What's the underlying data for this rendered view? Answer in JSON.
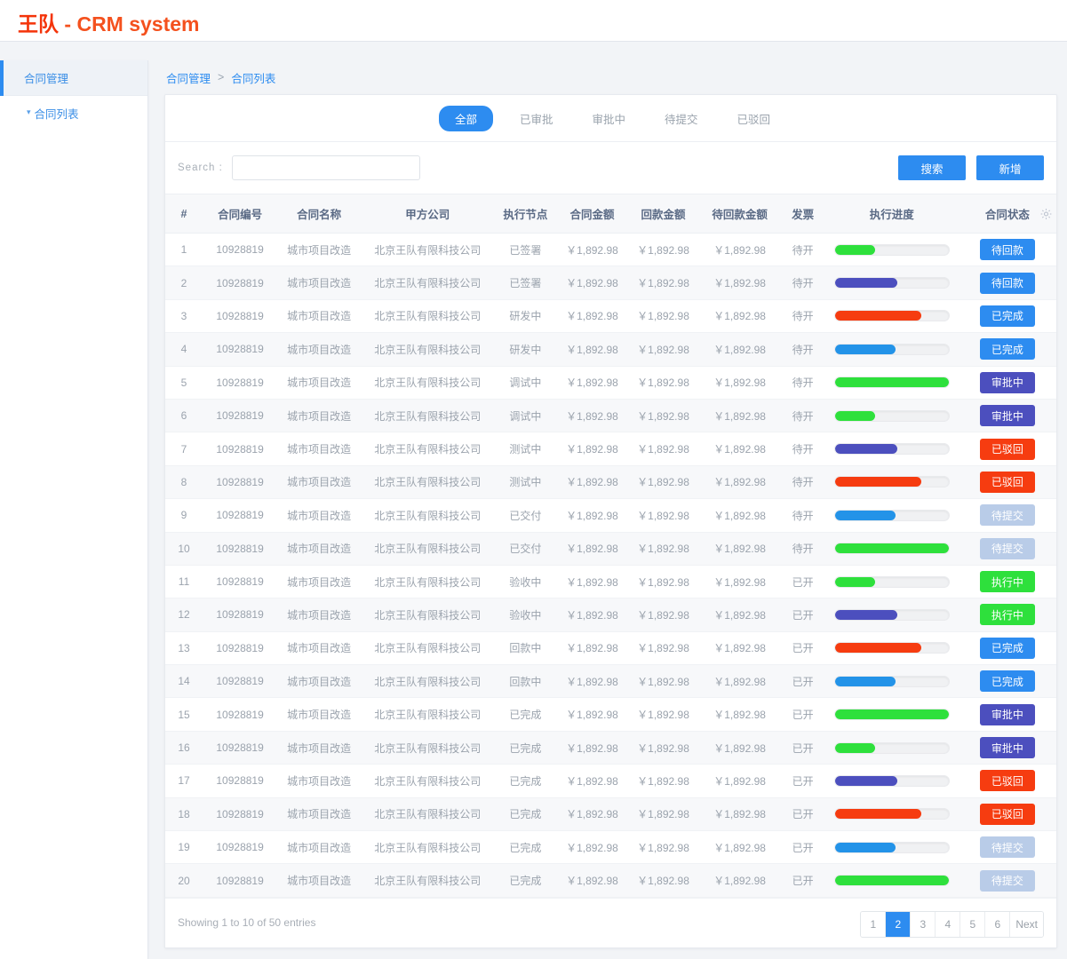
{
  "header": {
    "brand_cn": "王队",
    "brand_sep": " - ",
    "brand_en": "CRM system",
    "brand_color": "#f4511e"
  },
  "sidebar": {
    "items": [
      {
        "label": "合同管理",
        "active": true
      },
      {
        "label": "合同列表",
        "sub": true,
        "chevron": "chevron-down-icon"
      }
    ]
  },
  "breadcrumb": {
    "parent": "合同管理",
    "separator": ">",
    "current": "合同列表"
  },
  "tabs": [
    {
      "label": "全部",
      "active": true
    },
    {
      "label": "已审批",
      "active": false
    },
    {
      "label": "审批中",
      "active": false
    },
    {
      "label": "待提交",
      "active": false
    },
    {
      "label": "已驳回",
      "active": false
    }
  ],
  "search": {
    "label": "Search :",
    "value": "",
    "placeholder": "",
    "search_button": "搜索",
    "add_button": "新增"
  },
  "table": {
    "columns": [
      "#",
      "合同编号",
      "合同名称",
      "甲方公司",
      "执行节点",
      "合同金额",
      "回款金额",
      "待回款金额",
      "发票",
      "执行进度",
      "合同状态"
    ],
    "settings_icon": "gear-icon",
    "rows": [
      {
        "index": "1",
        "code": "10928819",
        "name": "城市项目改造",
        "company": "北京王队有限科技公司",
        "node": "已签署",
        "amount": "￥1,892.98",
        "received": "￥1,892.98",
        "pending": "￥1,892.98",
        "invoice": "待开",
        "progress": 35,
        "progress_color": "#2ee03c",
        "status": "待回款",
        "status_color": "#2d8cf0"
      },
      {
        "index": "2",
        "code": "10928819",
        "name": "城市项目改造",
        "company": "北京王队有限科技公司",
        "node": "已签署",
        "amount": "￥1,892.98",
        "received": "￥1,892.98",
        "pending": "￥1,892.98",
        "invoice": "待开",
        "progress": 55,
        "progress_color": "#4c4fbe",
        "status": "待回款",
        "status_color": "#2d8cf0"
      },
      {
        "index": "3",
        "code": "10928819",
        "name": "城市项目改造",
        "company": "北京王队有限科技公司",
        "node": "研发中",
        "amount": "￥1,892.98",
        "received": "￥1,892.98",
        "pending": "￥1,892.98",
        "invoice": "待开",
        "progress": 76,
        "progress_color": "#f63c10",
        "status": "已完成",
        "status_color": "#2d8cf0"
      },
      {
        "index": "4",
        "code": "10928819",
        "name": "城市项目改造",
        "company": "北京王队有限科技公司",
        "node": "研发中",
        "amount": "￥1,892.98",
        "received": "￥1,892.98",
        "pending": "￥1,892.98",
        "invoice": "待开",
        "progress": 53,
        "progress_color": "#2393e8",
        "status": "已完成",
        "status_color": "#2d8cf0"
      },
      {
        "index": "5",
        "code": "10928819",
        "name": "城市项目改造",
        "company": "北京王队有限科技公司",
        "node": "调试中",
        "amount": "￥1,892.98",
        "received": "￥1,892.98",
        "pending": "￥1,892.98",
        "invoice": "待开",
        "progress": 100,
        "progress_color": "#2ee03c",
        "status": "审批中",
        "status_color": "#4c4fbe"
      },
      {
        "index": "6",
        "code": "10928819",
        "name": "城市项目改造",
        "company": "北京王队有限科技公司",
        "node": "调试中",
        "amount": "￥1,892.98",
        "received": "￥1,892.98",
        "pending": "￥1,892.98",
        "invoice": "待开",
        "progress": 35,
        "progress_color": "#2ee03c",
        "status": "审批中",
        "status_color": "#4c4fbe"
      },
      {
        "index": "7",
        "code": "10928819",
        "name": "城市项目改造",
        "company": "北京王队有限科技公司",
        "node": "测试中",
        "amount": "￥1,892.98",
        "received": "￥1,892.98",
        "pending": "￥1,892.98",
        "invoice": "待开",
        "progress": 55,
        "progress_color": "#4c4fbe",
        "status": "已驳回",
        "status_color": "#f63c10"
      },
      {
        "index": "8",
        "code": "10928819",
        "name": "城市项目改造",
        "company": "北京王队有限科技公司",
        "node": "测试中",
        "amount": "￥1,892.98",
        "received": "￥1,892.98",
        "pending": "￥1,892.98",
        "invoice": "待开",
        "progress": 76,
        "progress_color": "#f63c10",
        "status": "已驳回",
        "status_color": "#f63c10"
      },
      {
        "index": "9",
        "code": "10928819",
        "name": "城市项目改造",
        "company": "北京王队有限科技公司",
        "node": "已交付",
        "amount": "￥1,892.98",
        "received": "￥1,892.98",
        "pending": "￥1,892.98",
        "invoice": "待开",
        "progress": 53,
        "progress_color": "#2393e8",
        "status": "待提交",
        "status_color": "#b9cce8"
      },
      {
        "index": "10",
        "code": "10928819",
        "name": "城市项目改造",
        "company": "北京王队有限科技公司",
        "node": "已交付",
        "amount": "￥1,892.98",
        "received": "￥1,892.98",
        "pending": "￥1,892.98",
        "invoice": "待开",
        "progress": 100,
        "progress_color": "#2ee03c",
        "status": "待提交",
        "status_color": "#b9cce8"
      },
      {
        "index": "11",
        "code": "10928819",
        "name": "城市项目改造",
        "company": "北京王队有限科技公司",
        "node": "验收中",
        "amount": "￥1,892.98",
        "received": "￥1,892.98",
        "pending": "￥1,892.98",
        "invoice": "已开",
        "progress": 35,
        "progress_color": "#2ee03c",
        "status": "执行中",
        "status_color": "#2ee03c"
      },
      {
        "index": "12",
        "code": "10928819",
        "name": "城市项目改造",
        "company": "北京王队有限科技公司",
        "node": "验收中",
        "amount": "￥1,892.98",
        "received": "￥1,892.98",
        "pending": "￥1,892.98",
        "invoice": "已开",
        "progress": 55,
        "progress_color": "#4c4fbe",
        "status": "执行中",
        "status_color": "#2ee03c"
      },
      {
        "index": "13",
        "code": "10928819",
        "name": "城市项目改造",
        "company": "北京王队有限科技公司",
        "node": "回款中",
        "amount": "￥1,892.98",
        "received": "￥1,892.98",
        "pending": "￥1,892.98",
        "invoice": "已开",
        "progress": 76,
        "progress_color": "#f63c10",
        "status": "已完成",
        "status_color": "#2d8cf0"
      },
      {
        "index": "14",
        "code": "10928819",
        "name": "城市项目改造",
        "company": "北京王队有限科技公司",
        "node": "回款中",
        "amount": "￥1,892.98",
        "received": "￥1,892.98",
        "pending": "￥1,892.98",
        "invoice": "已开",
        "progress": 53,
        "progress_color": "#2393e8",
        "status": "已完成",
        "status_color": "#2d8cf0"
      },
      {
        "index": "15",
        "code": "10928819",
        "name": "城市项目改造",
        "company": "北京王队有限科技公司",
        "node": "已完成",
        "amount": "￥1,892.98",
        "received": "￥1,892.98",
        "pending": "￥1,892.98",
        "invoice": "已开",
        "progress": 100,
        "progress_color": "#2ee03c",
        "status": "审批中",
        "status_color": "#4c4fbe"
      },
      {
        "index": "16",
        "code": "10928819",
        "name": "城市项目改造",
        "company": "北京王队有限科技公司",
        "node": "已完成",
        "amount": "￥1,892.98",
        "received": "￥1,892.98",
        "pending": "￥1,892.98",
        "invoice": "已开",
        "progress": 35,
        "progress_color": "#2ee03c",
        "status": "审批中",
        "status_color": "#4c4fbe"
      },
      {
        "index": "17",
        "code": "10928819",
        "name": "城市项目改造",
        "company": "北京王队有限科技公司",
        "node": "已完成",
        "amount": "￥1,892.98",
        "received": "￥1,892.98",
        "pending": "￥1,892.98",
        "invoice": "已开",
        "progress": 55,
        "progress_color": "#4c4fbe",
        "status": "已驳回",
        "status_color": "#f63c10"
      },
      {
        "index": "18",
        "code": "10928819",
        "name": "城市项目改造",
        "company": "北京王队有限科技公司",
        "node": "已完成",
        "amount": "￥1,892.98",
        "received": "￥1,892.98",
        "pending": "￥1,892.98",
        "invoice": "已开",
        "progress": 76,
        "progress_color": "#f63c10",
        "status": "已驳回",
        "status_color": "#f63c10"
      },
      {
        "index": "19",
        "code": "10928819",
        "name": "城市项目改造",
        "company": "北京王队有限科技公司",
        "node": "已完成",
        "amount": "￥1,892.98",
        "received": "￥1,892.98",
        "pending": "￥1,892.98",
        "invoice": "已开",
        "progress": 53,
        "progress_color": "#2393e8",
        "status": "待提交",
        "status_color": "#b9cce8"
      },
      {
        "index": "20",
        "code": "10928819",
        "name": "城市项目改造",
        "company": "北京王队有限科技公司",
        "node": "已完成",
        "amount": "￥1,892.98",
        "received": "￥1,892.98",
        "pending": "￥1,892.98",
        "invoice": "已开",
        "progress": 100,
        "progress_color": "#2ee03c",
        "status": "待提交",
        "status_color": "#b9cce8"
      }
    ]
  },
  "footer": {
    "info": "Showing 1 to 10 of 50 entries",
    "pages": [
      {
        "label": "1",
        "active": false
      },
      {
        "label": "2",
        "active": true
      },
      {
        "label": "3",
        "active": false
      },
      {
        "label": "4",
        "active": false
      },
      {
        "label": "5",
        "active": false
      },
      {
        "label": "6",
        "active": false
      },
      {
        "label": "Next",
        "active": false
      }
    ]
  }
}
